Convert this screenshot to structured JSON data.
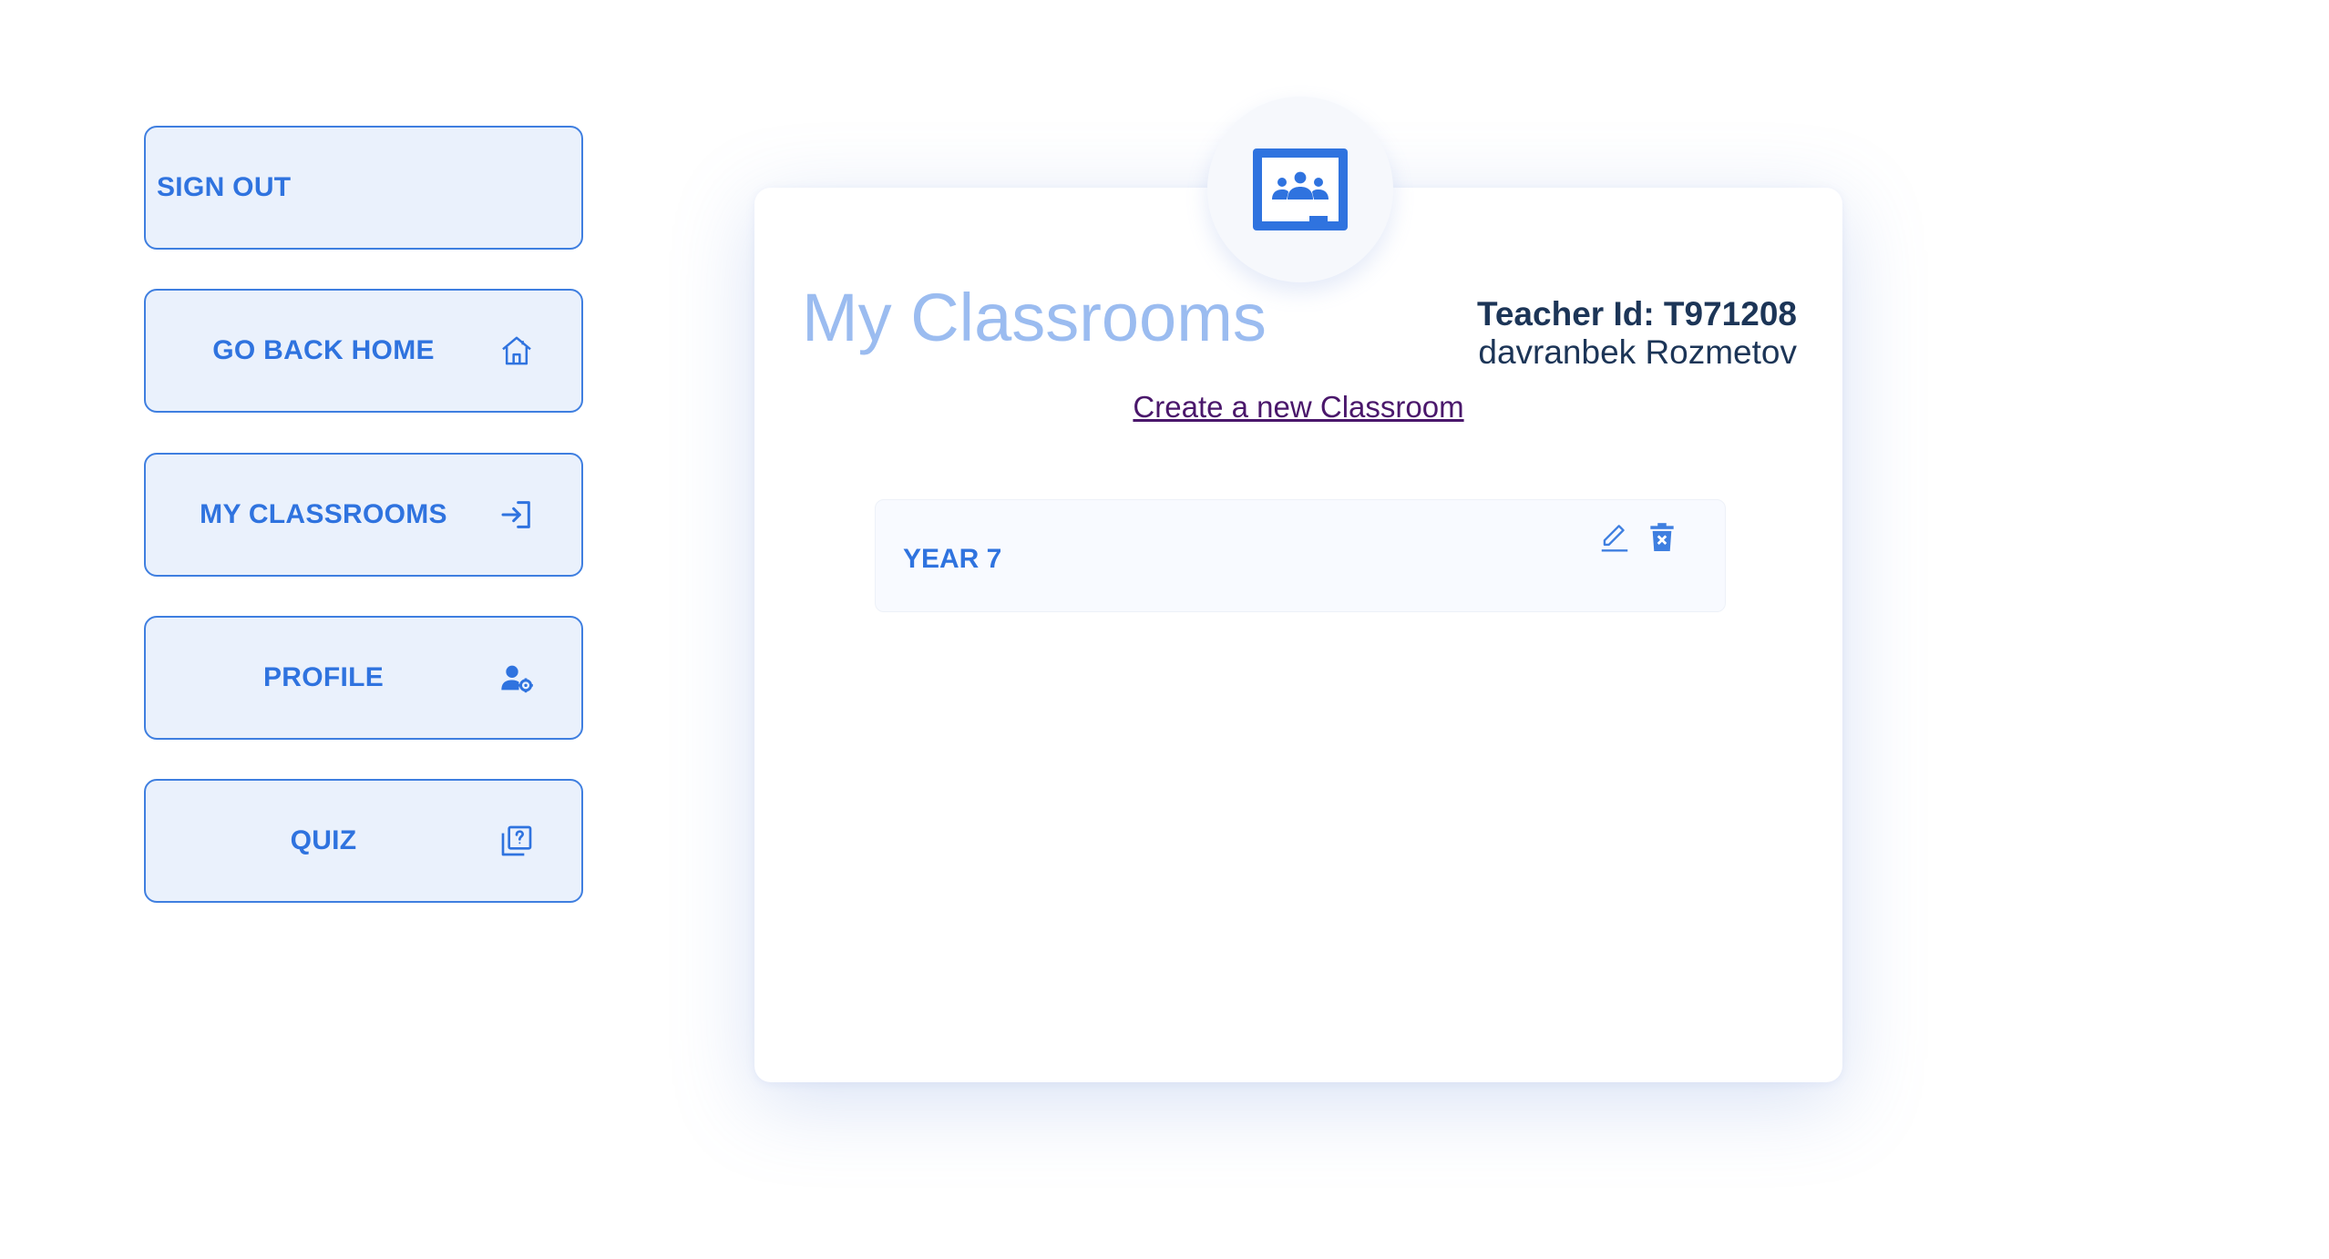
{
  "sidebar": {
    "sign_out": "SIGN OUT",
    "go_back_home": "GO BACK HOME",
    "my_classrooms": "MY CLASSROOMS",
    "profile": "PROFILE",
    "quiz": "QUIZ"
  },
  "main": {
    "title": "My Classrooms",
    "teacher_id": "Teacher Id: T971208",
    "teacher_name": "davranbek Rozmetov",
    "create_link": "Create a new Classroom",
    "classrooms": [
      {
        "name": "YEAR 7"
      }
    ]
  },
  "icons": {
    "badge": "google-classroom-icon",
    "home": "home-icon",
    "classrooms": "login-arrow-icon",
    "profile": "user-gear-icon",
    "quiz": "question-box-icon",
    "edit": "pencil-icon",
    "delete": "trash-x-icon"
  },
  "colors": {
    "accent": "#2f73df",
    "button_bg": "#eaf1fc",
    "title": "#9bbcf0",
    "text_dark": "#1c3557",
    "link": "#4a176b"
  }
}
